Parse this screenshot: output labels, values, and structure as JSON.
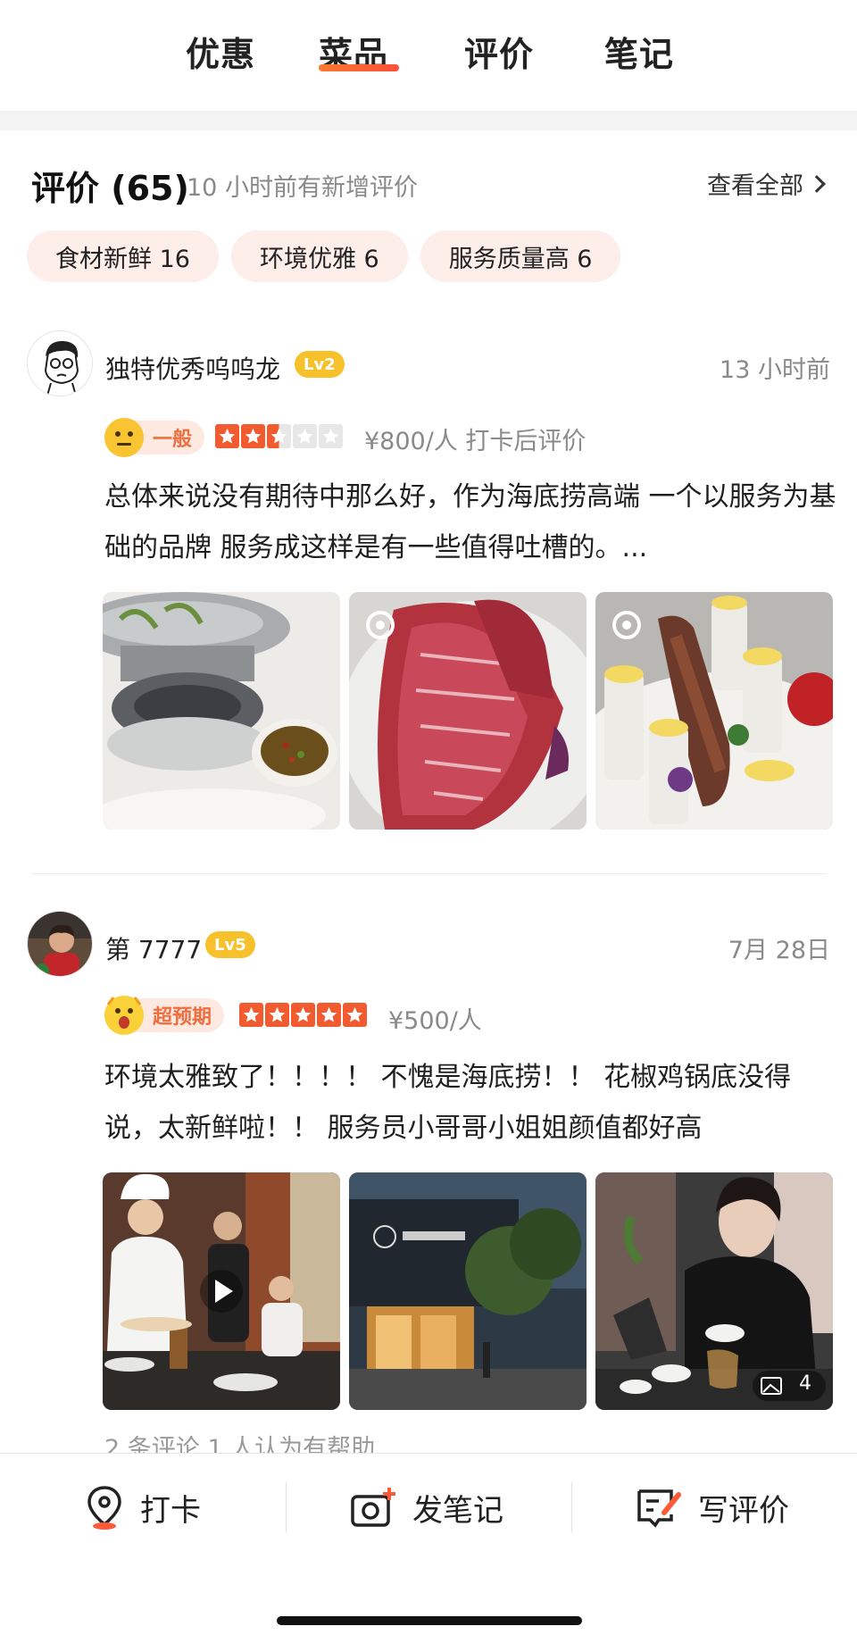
{
  "tabs": [
    {
      "label": "优惠",
      "active": false
    },
    {
      "label": "菜品",
      "active": true
    },
    {
      "label": "评价",
      "active": false
    },
    {
      "label": "笔记",
      "active": false
    }
  ],
  "reviews_header": {
    "title": "评价 (65)",
    "subtitle": "10 小时前有新增评价",
    "view_all": "查看全部"
  },
  "tags": [
    {
      "label": "食材新鲜 16"
    },
    {
      "label": "环境优雅 6"
    },
    {
      "label": "服务质量高 6"
    }
  ],
  "reviews": [
    {
      "user": "独特优秀呜呜龙",
      "level": "Lv2",
      "time": "13 小时前",
      "mood": "一般",
      "rating": 2.5,
      "price": "¥800/人  打卡后评价",
      "text": "总体来说没有期待中那么好，作为海底捞高端 一个以服务为基础的品牌 服务成这样是有一些值得吐槽的。..."
    },
    {
      "user": "第 7777",
      "level": "Lv5",
      "time": "7月 28日",
      "mood": "超预期",
      "rating": 5,
      "price": "¥500/人",
      "text": "环境太雅致了！！！！ 不愧是海底捞！！ 花椒鸡锅底没得说，太新鲜啦！！ 服务员小哥哥小姐姐颜值都好高",
      "photo_count": "4",
      "meta": "2 条评论    1 人认为有帮助"
    }
  ],
  "bottom_bar": {
    "checkin": "打卡",
    "post_note": "发笔记",
    "write_review": "写评价"
  },
  "colors": {
    "accent": "#ff5a36",
    "tag_bg": "#fdeeea",
    "level_badge": "#f7c12c",
    "star": "#f25b30"
  }
}
